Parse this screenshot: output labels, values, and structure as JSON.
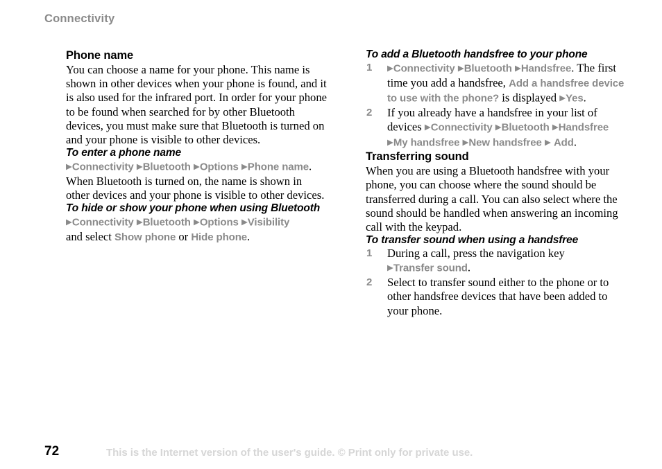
{
  "running_head": "Connectivity",
  "colors": {
    "menu_gray": "#8a8a8a",
    "heading_black": "#000000",
    "footer_watermark": "#d6d6d6"
  },
  "arrow_glyph": "▶",
  "left_column": {
    "section_heading": "Phone name",
    "intro_paragraph": "You can choose a name for your phone. This name is shown in other devices when your phone is found, and it is also used for the infrared port. In order for your phone to be found when searched for by other Bluetooth devices, you must make sure that Bluetooth is turned on and your phone is visible to other devices.",
    "task1": {
      "heading": "To enter a phone name",
      "menu_1": "Connectivity",
      "menu_2": "Bluetooth",
      "menu_3": "Options",
      "menu_4": "Phone name",
      "after_menu_text": ".  When Bluetooth is turned on, the name is shown in other devices and your phone is visible to other devices."
    },
    "task2": {
      "heading": "To hide or show your phone when using Bluetooth",
      "menu_1": "Connectivity",
      "menu_2": "Bluetooth",
      "menu_3": "Options",
      "menu_4": "Visibility",
      "select_lead": "and select ",
      "option_1": "Show phone",
      "option_separator": " or ",
      "option_2": "Hide phone",
      "trailing_period": "."
    }
  },
  "right_column": {
    "task1": {
      "heading": "To add a Bluetooth handsfree to your phone",
      "steps": [
        {
          "number": "1",
          "menu_1": "Connectivity",
          "menu_2": "Bluetooth",
          "menu_3": "Handsfree",
          "text_a": ". The first time you add a handsfree, ",
          "prompt": "Add a handsfree device to use with the phone?",
          "text_b": " is displayed ",
          "menu_4": "Yes",
          "trailing_period": "."
        },
        {
          "number": "2",
          "text_a": "If you already have a handsfree in your list of devices ",
          "menu_1": "Connectivity",
          "menu_2": "Bluetooth",
          "menu_3": "Handsfree",
          "menu_4": "My handsfree",
          "menu_5": "New handsfree",
          "menu_6": "Add",
          "trailing_period": "."
        }
      ]
    },
    "section_heading": "Transferring sound",
    "section_paragraph": "When you are using a Bluetooth handsfree with your phone, you can choose where the sound should be transferred during a call. You can also select where the sound should be handled when answering an incoming call with the keypad.",
    "task2": {
      "heading": "To transfer sound when using a handsfree",
      "steps": [
        {
          "number": "1",
          "text_a": "During a call, press the navigation key ",
          "menu_1": "Transfer sound",
          "trailing_period": "."
        },
        {
          "number": "2",
          "text_a": "Select to transfer sound either to the phone or to other handsfree devices that have been added to your phone."
        }
      ]
    }
  },
  "footer": {
    "page_number": "72",
    "note": "This is the Internet version of the user's guide. © Print only for private use."
  }
}
